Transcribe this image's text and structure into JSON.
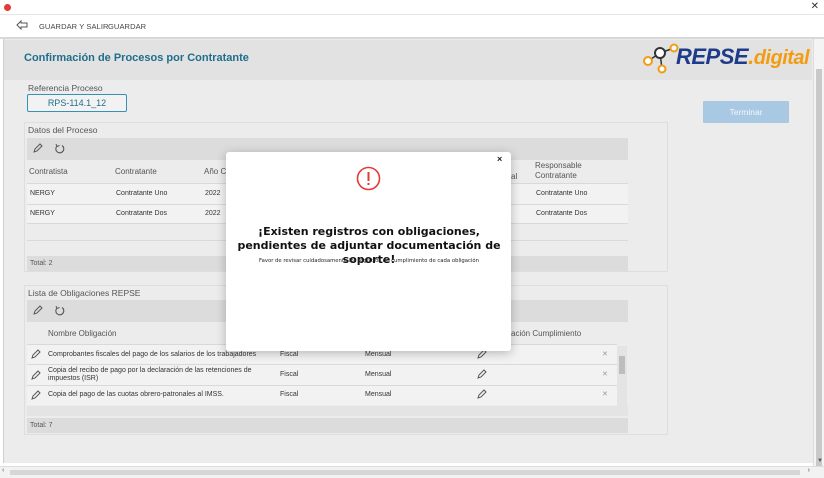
{
  "toolbar": {
    "save_exit_label": "GUARDAR Y SALIR",
    "save_label": "GUARDAR"
  },
  "page": {
    "title": "Confirmación de Procesos por Contratante",
    "logo_main": "REPSE",
    "logo_dot": ".",
    "logo_suffix": "digital"
  },
  "reference": {
    "label": "Referencia Proceso",
    "value": "RPS-114.1_12"
  },
  "terminar_label": "Terminar",
  "process_section": {
    "title": "Datos del Proceso",
    "columns": [
      "Contratista",
      "Contratante",
      "Año C",
      "al",
      "Responsable Contratante"
    ],
    "rows": [
      {
        "contratista": "NERGY",
        "contratante": "Contratante Uno",
        "anio": "2022",
        "responsable": "Contratante Uno"
      },
      {
        "contratista": "NERGY",
        "contratante": "Contratante Dos",
        "anio": "2022",
        "responsable": "Contratante Dos"
      }
    ],
    "total": "Total: 2"
  },
  "obligations_section": {
    "title": "Lista de Obligaciones REPSE",
    "columns": [
      "Nombre Obligación",
      "ación Cumplimiento"
    ],
    "rows": [
      {
        "name": "Comprobantes fiscales del pago de los salarios de los trabajadores",
        "type": "Fiscal",
        "period": "Mensual"
      },
      {
        "name": "Copia del recibo de pago por la declaración de las retenciones de impuestos (ISR)",
        "type": "Fiscal",
        "period": "Mensual"
      },
      {
        "name": "Copia del pago de las cuotas obrero-patronales al IMSS.",
        "type": "Fiscal",
        "period": "Mensual"
      }
    ],
    "total": "Total: 7"
  },
  "modal": {
    "title": "¡Existen registros con obligaciones, pendientes de adjuntar documentación de soporte!",
    "subtitle": "Favor de revisar cuidadosamente los registros de cumplimiento de cada obligación",
    "close_glyph": "×"
  },
  "colors": {
    "accent": "#1f6e8c",
    "terminar_bg": "#a9c8e4",
    "alert_red": "#e53935",
    "logo_blue": "#1e3a8a",
    "logo_orange": "#f39c12"
  }
}
